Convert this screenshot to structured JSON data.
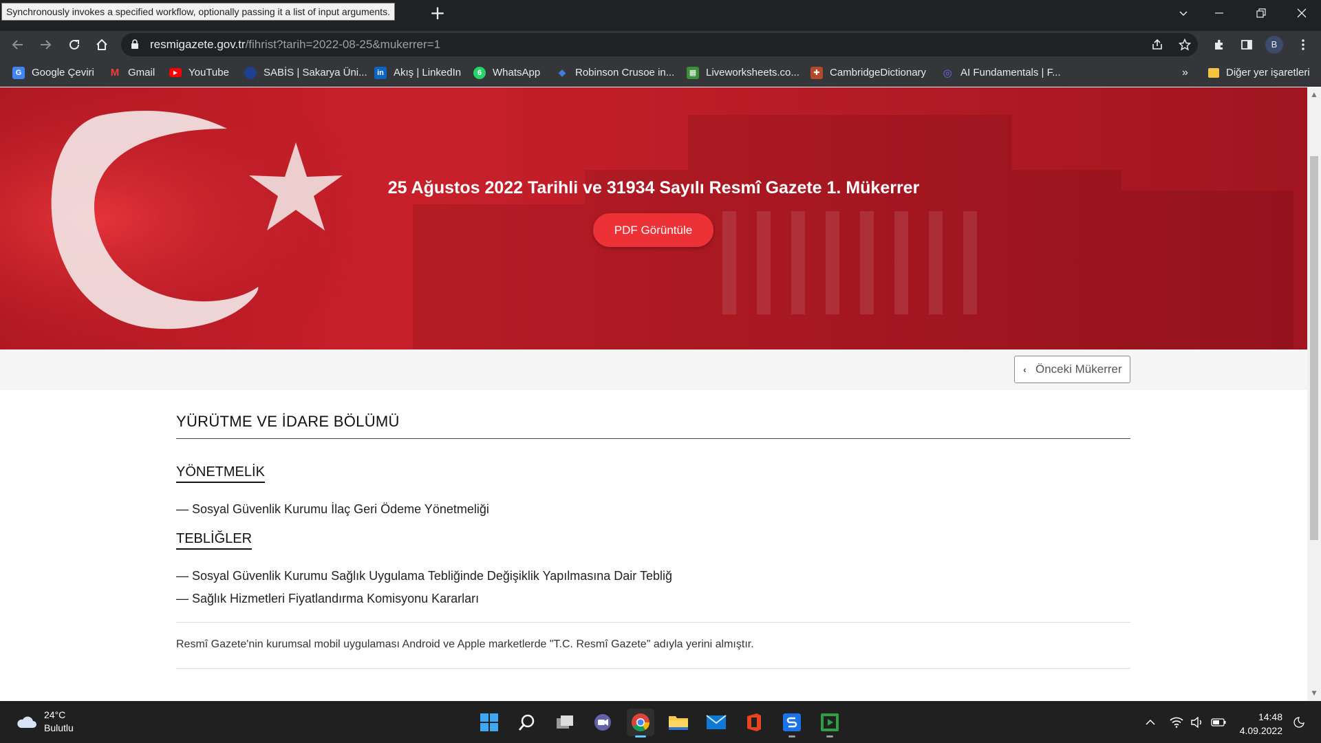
{
  "browser": {
    "tooltip": "Synchronously invokes a specified workflow, optionally passing it a list of input arguments.",
    "new_tab_symbol": "+",
    "url_host": "resmigazete.gov.tr",
    "url_path": "/fihrist?tarih=2022-08-25&mukerrer=1",
    "profile_initial": "B",
    "icons": [
      "back-arrow-icon",
      "forward-arrow-icon",
      "reload-icon",
      "home-icon",
      "lock-icon",
      "share-icon",
      "star-icon",
      "extensions-icon",
      "sidepanel-icon",
      "menu-dots-icon"
    ]
  },
  "bookmarks": {
    "items": [
      {
        "label": "Google Çeviri",
        "icon": "google-translate-icon",
        "color": "#4285f4",
        "glyph": "G"
      },
      {
        "label": "Gmail",
        "icon": "gmail-icon",
        "color": "#ea4335",
        "glyph": "M"
      },
      {
        "label": "YouTube",
        "icon": "youtube-icon",
        "color": "#ff0000",
        "glyph": "▶"
      },
      {
        "label": "SABİS | Sakarya Üni...",
        "icon": "sabis-icon",
        "color": "#1f3f8f",
        "glyph": "●"
      },
      {
        "label": "Akış | LinkedIn",
        "icon": "linkedin-icon",
        "color": "#0a66c2",
        "glyph": "in"
      },
      {
        "label": "WhatsApp",
        "icon": "whatsapp-icon",
        "color": "#25d366",
        "glyph": "6"
      },
      {
        "label": "Robinson Crusoe in...",
        "icon": "robinson-icon",
        "color": "#2b6cb0",
        "glyph": "◆"
      },
      {
        "label": "Liveworksheets.co...",
        "icon": "liveworksheets-icon",
        "color": "#3a8f3a",
        "glyph": "▦"
      },
      {
        "label": "CambridgeDictionary",
        "icon": "cambridge-icon",
        "color": "#b5492c",
        "glyph": "✚"
      },
      {
        "label": "AI Fundamentals | F...",
        "icon": "ai-fundamentals-icon",
        "color": "#3b3bd6",
        "glyph": "◎"
      }
    ],
    "overflow": "»",
    "other_label": "Diğer yer işaretleri"
  },
  "page": {
    "hero_title": "25 Ağustos 2022 Tarihli ve 31934 Sayılı Resmî Gazete 1. Mükerrer",
    "pdf_button": "PDF Görüntüle",
    "prev_button": "Önceki Mükerrer",
    "section_title": "YÜRÜTME VE İDARE BÖLÜMÜ",
    "categories": [
      {
        "title": "YÖNETMELİK",
        "items": [
          "— Sosyal Güvenlik Kurumu İlaç Geri Ödeme Yönetmeliği"
        ]
      },
      {
        "title": "TEBLİĞLER",
        "items": [
          "— Sosyal Güvenlik Kurumu Sağlık Uygulama Tebliğinde Değişiklik Yapılmasına Dair Tebliğ",
          "— Sağlık Hizmetleri Fiyatlandırma Komisyonu Kararları"
        ]
      }
    ],
    "notice": "Resmî Gazete'nin kurumsal mobil uygulaması Android ve Apple marketlerde \"T.C. Resmî Gazete\" adıyla yerini almıştır.",
    "colors": {
      "hero": "#c8202b",
      "pdf_button": "#ec3237"
    }
  },
  "taskbar": {
    "weather_temp": "24°C",
    "weather_desc": "Bulutlu",
    "time": "14:48",
    "date": "4.09.2022",
    "apps": [
      "start-icon",
      "search-icon",
      "task-view-icon",
      "teams-chat-icon",
      "chrome-icon",
      "file-explorer-icon",
      "mail-icon",
      "office-icon",
      "sabis-app-icon",
      "media-player-icon"
    ]
  }
}
